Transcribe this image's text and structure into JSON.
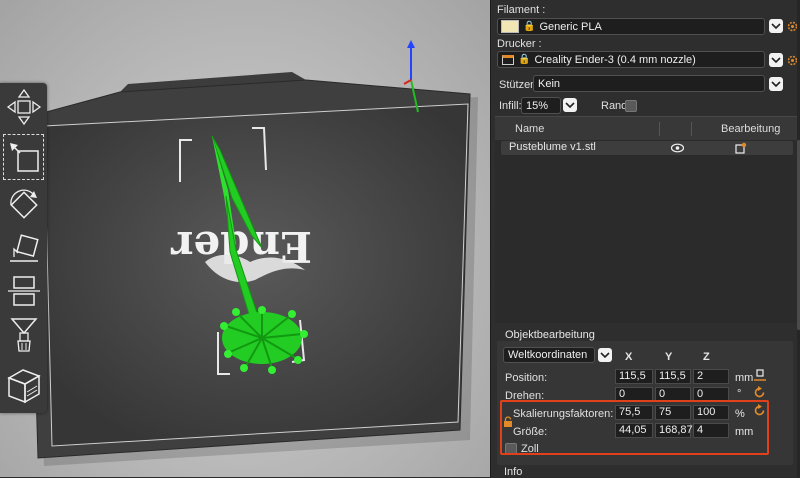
{
  "panel": {
    "filament": {
      "label": "Filament :",
      "value": "Generic PLA"
    },
    "printer": {
      "label": "Drucker :",
      "value": "Creality Ender-3 (0.4 mm nozzle)"
    },
    "supports": {
      "label": "Stützen:",
      "value": "Kein"
    },
    "infill": {
      "label": "Infill:",
      "value": "15%"
    },
    "brim": {
      "label": "Rand:"
    },
    "objects_table": {
      "col_name": "Name",
      "col_edit": "Bearbeitung",
      "rows": [
        {
          "name": "Pusteblume v1.stl"
        }
      ]
    },
    "object_manipulation": {
      "title": "Objektbearbeitung",
      "coordinates": "Weltkoordinaten",
      "axes": {
        "x": "X",
        "y": "Y",
        "z": "Z"
      },
      "position": {
        "label": "Position:",
        "x": "115,5",
        "y": "115,5",
        "z": "2",
        "unit": "mm"
      },
      "rotation": {
        "label": "Drehen:",
        "x": "0",
        "y": "0",
        "z": "0",
        "unit": "°"
      },
      "scale": {
        "label": "Skalierungsfaktoren:",
        "x": "75,5",
        "y": "75",
        "z": "100",
        "unit": "%"
      },
      "size": {
        "label": "Größe:",
        "x": "44,05",
        "y": "168,87",
        "z": "4",
        "unit": "mm"
      },
      "inch": {
        "label": "Zoll"
      }
    },
    "info": {
      "label": "Info"
    }
  },
  "viewport": {
    "bed_logo_text": "Ender"
  },
  "colors": {
    "model": "#22cc22",
    "highlight": "#e0401a",
    "bed": "#3a3a3a",
    "panel": "#2e2e2e"
  },
  "icons": [
    "lock-icon",
    "chevron-down-icon",
    "gear-icon",
    "eye-icon",
    "edit-icon",
    "reset-icon",
    "move-icon",
    "scale-icon",
    "rotate-icon",
    "place-face-icon",
    "cut-icon",
    "support-paint-icon",
    "seam-paint-icon",
    "view-cube-icon"
  ]
}
